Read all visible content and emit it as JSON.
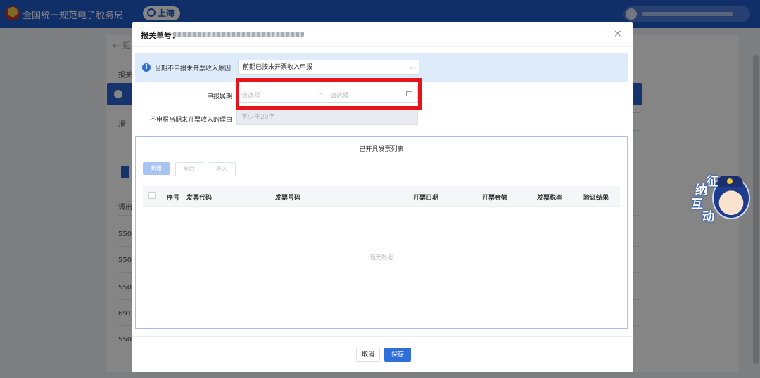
{
  "app": {
    "title": "全国统一规范电子税务局",
    "city": "上海"
  },
  "background": {
    "back_label": "← 返",
    "rows": [
      "报关",
      "报",
      "调出",
      "550",
      "550",
      "550",
      "691",
      "550"
    ]
  },
  "mascot": {
    "chars": [
      "纳",
      "征",
      "互",
      "动"
    ]
  },
  "modal": {
    "title": "报关单号：",
    "close_label": "×",
    "info_label": "当期不申报未开票收入原因",
    "reason_select_value": "前期已按未开票收入申报",
    "period_label": "申报属期",
    "period_start_placeholder": "请选择",
    "period_separator": "-",
    "period_end_placeholder": "请选择",
    "no_declare_reason_label": "不申报当期未开票收入的理由",
    "no_declare_reason_placeholder": "不少于20字",
    "list_title": "已开具发票列表",
    "toolbar": {
      "add": "新增",
      "delete": "删除",
      "import": "导入"
    },
    "columns": [
      "序号",
      "发票代码",
      "发票号码",
      "开票日期",
      "开票金额",
      "发票税率",
      "验证结果"
    ],
    "empty_text": "暂无数据",
    "footer": {
      "cancel": "取消",
      "save": "保存"
    }
  },
  "colors": {
    "primary": "#2f6fd8",
    "highlight": "#e3141b",
    "info_bg": "#deebfb"
  }
}
